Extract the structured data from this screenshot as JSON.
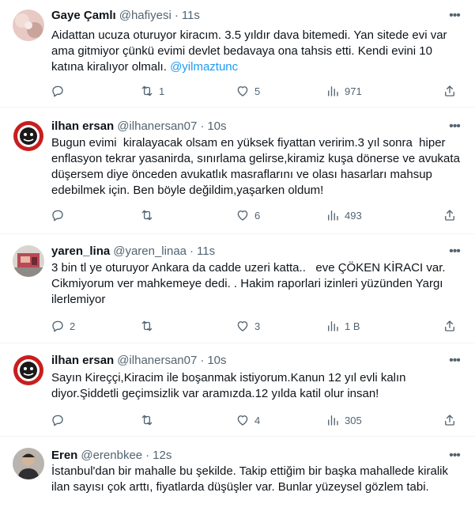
{
  "tweets": [
    {
      "name": "Gaye Çamlı",
      "handle": "@hafiyesi",
      "time": "11s",
      "text_before": "Aidattan ucuza oturuyor kiracım. 3.5 yıldır dava bitemedi. Yan sitede evi var ama gitmiyor çünkü evimi devlet bedavaya ona tahsis etti. Kendi evini 10 katına kiralıyor olmalı. ",
      "mention": "@yilmaztunc",
      "replies": "",
      "retweets": "1",
      "likes": "5",
      "views": "971"
    },
    {
      "name": "ilhan ersan",
      "handle": "@ilhanersan07",
      "time": "10s",
      "text": "Bugun evimi  kiralayacak olsam en yüksek fiyattan veririm.3 yıl sonra  hiper enflasyon tekrar yasanirda, sınırlama gelirse,kiramiz kuşa dönerse ve avukata düşersem diye önceden avukatlık masraflarını ve olası hasarları mahsup edebilmek için. Ben böyle değildim,yaşarken oldum!",
      "replies": "",
      "retweets": "",
      "likes": "6",
      "views": "493"
    },
    {
      "name": "yaren_lina",
      "handle": "@yaren_linaa",
      "time": "11s",
      "text": "3 bin tl ye oturuyor Ankara da cadde uzeri katta..   eve ÇÖKEN KİRACI var. Cikmiyorum ver mahkemeye dedi. . Hakim raporlari izinleri yüzünden Yargı ilerlemiyor",
      "replies": "2",
      "retweets": "",
      "likes": "3",
      "views": "1 B"
    },
    {
      "name": "ilhan ersan",
      "handle": "@ilhanersan07",
      "time": "10s",
      "text": "Sayın Kireççi,Kiracim ile boşanmak istiyorum.Kanun 12 yıl evli kalın diyor.Şiddetli geçimsizlik var aramızda.12 yılda katil olur insan!",
      "replies": "",
      "retweets": "",
      "likes": "4",
      "views": "305"
    },
    {
      "name": "Eren",
      "handle": "@erenbkee",
      "time": "12s",
      "text": "İstanbul'dan bir mahalle bu şekilde. Takip ettiğim bir başka mahallede kiralik ilan sayısı çok arttı, fiyatlarda düşüşler var. Bunlar yüzeysel gözlem tabi."
    }
  ],
  "icons": {
    "reply": "reply-icon",
    "retweet": "retweet-icon",
    "like": "like-icon",
    "views": "views-icon",
    "share": "share-icon",
    "more": "more-icon"
  },
  "colors": {
    "secondary_text": "#536471",
    "mention": "#1d9bf0",
    "divider": "#eff3f4"
  }
}
